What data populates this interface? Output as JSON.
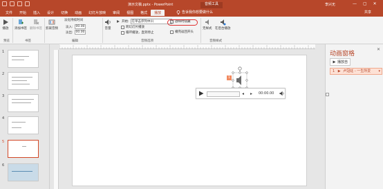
{
  "window": {
    "title": "演示文稿.pptx - PowerPoint",
    "tools_label": "音频工具",
    "user": "李兴无",
    "controls": [
      "—",
      "▢",
      "✕"
    ]
  },
  "tabs": [
    "文件",
    "开始",
    "插入",
    "设计",
    "切换",
    "动画",
    "幻灯片放映",
    "审阅",
    "视图",
    "格式",
    "播放"
  ],
  "active_tab": "播放",
  "tellme": "告诉我你想要做什么",
  "share": "共享",
  "ribbon": {
    "preview_btn": "播放",
    "add_bookmark": "添加书签",
    "remove_bookmark": "删除书签",
    "trim_audio": "剪裁音频",
    "fade_duration": "淡化持续时间",
    "fade_in": "淡入:",
    "fade_in_val": "00.00",
    "fade_out": "淡出:",
    "fade_out_val": "00.00",
    "volume": "音量",
    "start_label": "开始:",
    "start_value": "在单击序列中(I)",
    "cross_slides": "跨幻灯片播放",
    "loop_until_stop": "循环播放，直到停止",
    "hide_during_show": "放映时隐藏",
    "rewind_after": "播完返回开头",
    "no_style": "无样式",
    "play_in_bg": "在后台播放",
    "groups": {
      "preview": "预览",
      "bookmarks": "书签",
      "editing": "编辑",
      "audio_options": "音频选项",
      "audio_styles": "音频样式"
    }
  },
  "thumbnails": [
    {
      "num": "1"
    },
    {
      "num": "2"
    },
    {
      "num": "3"
    },
    {
      "num": "4"
    },
    {
      "num": "5"
    },
    {
      "num": "6"
    }
  ],
  "player": {
    "time": "00:00.00",
    "play_icon": "play-icon",
    "volume_icon": "speaker-icon"
  },
  "anim_tag": "1",
  "anim_pane": {
    "title": "动画窗格",
    "play_button": "播放自",
    "item_index": "1",
    "item_label": "卢冠廷 - 一生所爱"
  },
  "colors": {
    "brand": "#b7472a",
    "highlight": "#e03030"
  }
}
